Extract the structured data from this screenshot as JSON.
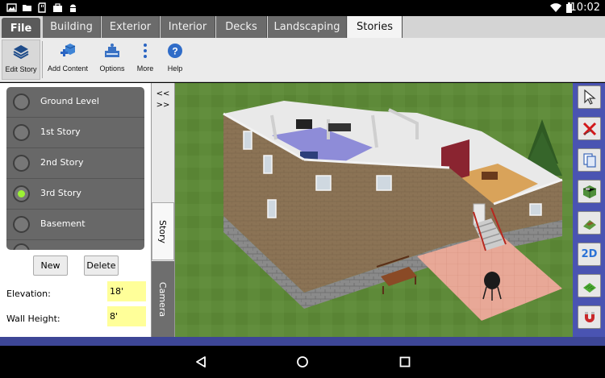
{
  "status_bar": {
    "time": "10:02",
    "icons": [
      "image-icon",
      "folder-icon",
      "sd-card-icon",
      "briefcase-icon",
      "android-icon",
      "wifi-icon",
      "battery-icon"
    ]
  },
  "tabs": {
    "file_label": "File",
    "items": [
      {
        "label": "Building",
        "active": false
      },
      {
        "label": "Exterior",
        "active": false
      },
      {
        "label": "Interior",
        "active": false
      },
      {
        "label": "Decks",
        "active": false
      },
      {
        "label": "Landscaping",
        "active": false
      },
      {
        "label": "Stories",
        "active": true
      }
    ]
  },
  "toolbar": {
    "edit_story": "Edit Story",
    "add_content": "Add Content",
    "options": "Options",
    "more": "More",
    "help": "Help"
  },
  "stories_panel": {
    "items": [
      {
        "label": "Ground Level",
        "selected": false
      },
      {
        "label": "1st Story",
        "selected": false
      },
      {
        "label": "2nd Story",
        "selected": false
      },
      {
        "label": "3rd Story",
        "selected": true
      },
      {
        "label": "Basement",
        "selected": false
      }
    ],
    "new_button": "New",
    "delete_button": "Delete",
    "elevation_label": "Elevation:",
    "elevation_value": "18'",
    "wall_height_label": "Wall Height:",
    "wall_height_value": "8'"
  },
  "side_tabs": {
    "toggle": "<<\n>>",
    "story": "Story",
    "camera": "Camera"
  },
  "right_tools": [
    "pointer-icon",
    "delete-x-icon",
    "copy-icon",
    "cube-icon",
    "terrain-icon",
    "2D",
    "grass-icon",
    "magnet-icon"
  ],
  "colors": {
    "accent_blue": "#4a54b2",
    "radio_selected": "#9cf234",
    "field_highlight": "#ffff99",
    "grass": "#5f8a3b"
  }
}
